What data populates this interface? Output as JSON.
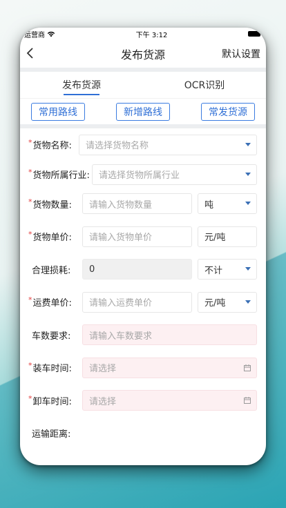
{
  "status": {
    "carrier": "运营商",
    "time": "下午 3:12"
  },
  "nav": {
    "back_icon": "chevron-left-icon",
    "title": "发布货源",
    "right": "默认设置"
  },
  "tabs": [
    {
      "label": "发布货源",
      "active": true
    },
    {
      "label": "OCR识别",
      "active": false
    }
  ],
  "quick_buttons": {
    "common_routes": "常用路线",
    "new_route": "新增路线",
    "frequent_cargo": "常发货源"
  },
  "form": {
    "cargo_name": {
      "label": "货物名称:",
      "placeholder": "请选择货物名称",
      "required": true
    },
    "industry": {
      "label": "货物所属行业:",
      "placeholder": "请选择货物所属行业",
      "required": true
    },
    "quantity": {
      "label": "货物数量:",
      "placeholder": "请输入货物数量",
      "unit": "吨",
      "required": true
    },
    "unit_price": {
      "label": "货物单价:",
      "placeholder": "请输入货物单价",
      "unit": "元/吨",
      "required": true
    },
    "loss": {
      "label": "合理损耗:",
      "value": "0",
      "unit": "不计",
      "required": false
    },
    "freight_price": {
      "label": "运费单价:",
      "placeholder": "请输入运费单价",
      "unit": "元/吨",
      "required": true
    },
    "vehicles": {
      "label": "车数要求:",
      "placeholder": "请输入车数要求",
      "required": false
    },
    "load_time": {
      "label": "装车时间:",
      "placeholder": "请选择",
      "required": true
    },
    "unload_time": {
      "label": "卸车时间:",
      "placeholder": "请选择",
      "required": true
    },
    "distance": {
      "label": "运输距离:",
      "required": false
    }
  },
  "colors": {
    "accent": "#2f6fd6",
    "required": "#e23c3c",
    "teal": "#2ea9b6"
  }
}
